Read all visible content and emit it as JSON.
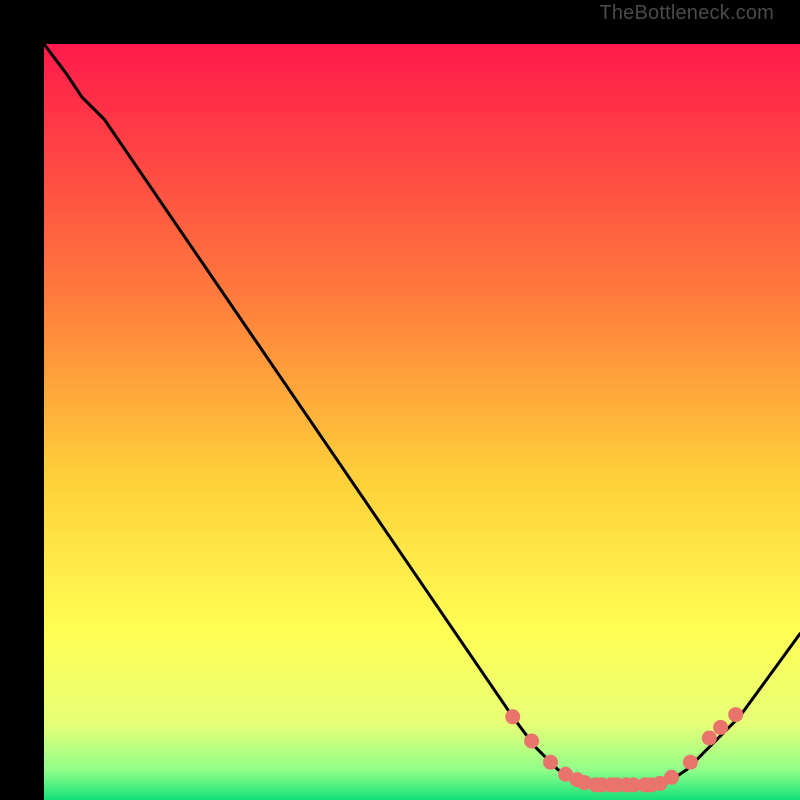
{
  "attribution": "TheBottleneck.com",
  "colors": {
    "top": "#ff1a4b",
    "mid1": "#ff7a3c",
    "mid2": "#ffd23a",
    "mid3": "#ffff55",
    "mid4": "#e6ff77",
    "mid5": "#92ff8a",
    "bottom": "#15e07a",
    "curve": "#000000",
    "dot": "#e9746c"
  },
  "chart_data": {
    "type": "line",
    "title": "",
    "xlabel": "",
    "ylabel": "",
    "xlim": [
      0,
      100
    ],
    "ylim": [
      0,
      100
    ],
    "curve": {
      "x": [
        0,
        3,
        5,
        8,
        62,
        65,
        68,
        72,
        82,
        85,
        88,
        92,
        100
      ],
      "y": [
        100,
        96,
        93,
        90,
        11,
        7,
        4,
        2,
        2,
        4,
        7,
        11,
        22
      ]
    },
    "series": [
      {
        "name": "highlight-dots",
        "x": [
          62,
          64.5,
          67,
          69,
          70.5,
          71.5,
          73,
          73.8,
          75,
          75.8,
          77,
          78,
          79.5,
          80.3,
          81.5,
          83,
          85.5,
          88,
          89.5,
          91.5
        ],
        "y": [
          11,
          7.8,
          5,
          3.4,
          2.7,
          2.3,
          2,
          2,
          2,
          2,
          2,
          2,
          2,
          2,
          2.2,
          3,
          5,
          8.2,
          9.6,
          11.3
        ]
      }
    ]
  }
}
